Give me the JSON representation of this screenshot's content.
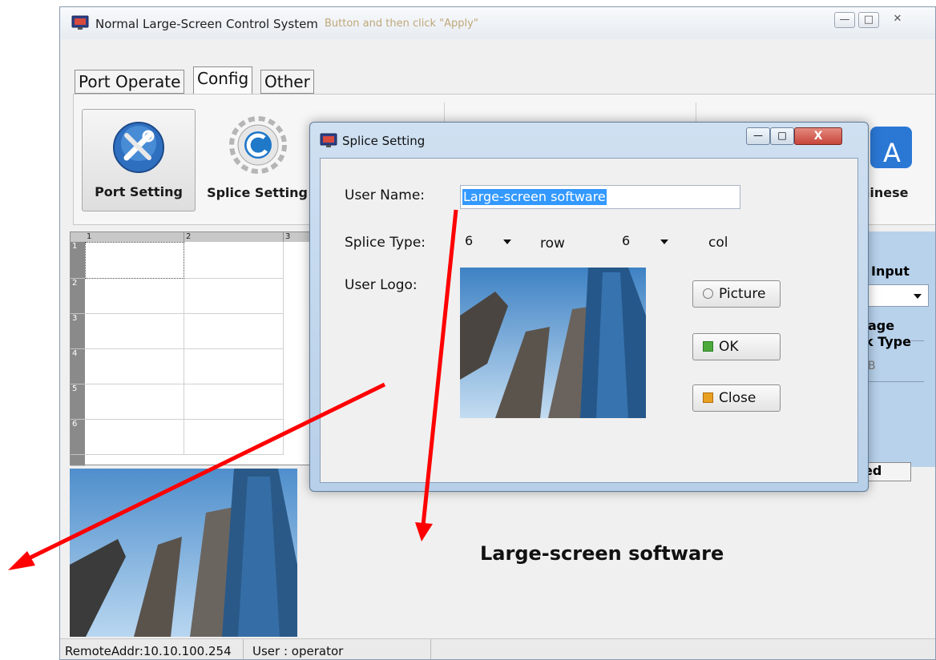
{
  "main_window": {
    "title": "Normal Large-Screen Control System",
    "title_overlay_text": "Button and then click \"Apply\"",
    "controls": {
      "minimize": "—",
      "maximize": "□",
      "close": "✕"
    },
    "tabs": [
      {
        "label": "Port Operate"
      },
      {
        "label": "Config"
      },
      {
        "label": "Other"
      }
    ],
    "active_tab": "Config",
    "ribbon": [
      {
        "label": "Port Setting",
        "icon": "tools-icon"
      },
      {
        "label": "Splice Setting",
        "icon": "splice-gear-icon"
      },
      {
        "label": "hinese",
        "icon": "language-icon"
      }
    ],
    "grid": {
      "columns": [
        "1",
        "2",
        "3"
      ],
      "rows": [
        "1",
        "2",
        "3",
        "4",
        "5",
        "6"
      ]
    },
    "right_panel": {
      "input_label": "Input",
      "image_label": "age",
      "type_label": "k Type",
      "type_value": "B",
      "cut_button": "ed"
    },
    "preview_caption": "Large-screen software",
    "status": {
      "remote_addr": "RemoteAddr:10.10.100.254",
      "user": "User : operator"
    }
  },
  "splice_dialog": {
    "title": "Splice Setting",
    "controls": {
      "minimize": "—",
      "maximize": "□",
      "close": "X"
    },
    "user_name_label": "User Name:",
    "user_name_value": "Large-screen software",
    "splice_type_label": "Splice Type:",
    "rows_value": "6",
    "row_label": "row",
    "cols_value": "6",
    "col_label": "col",
    "user_logo_label": "User Logo:",
    "buttons": {
      "picture": "Picture",
      "ok": "OK",
      "close": "Close"
    }
  },
  "colors": {
    "selection": "#3399ff",
    "annotation_arrow": "#ff0000",
    "dialog_frame": "#c4d9ef",
    "close_button": "#c7443a",
    "right_panel": "#b8d2ec"
  }
}
